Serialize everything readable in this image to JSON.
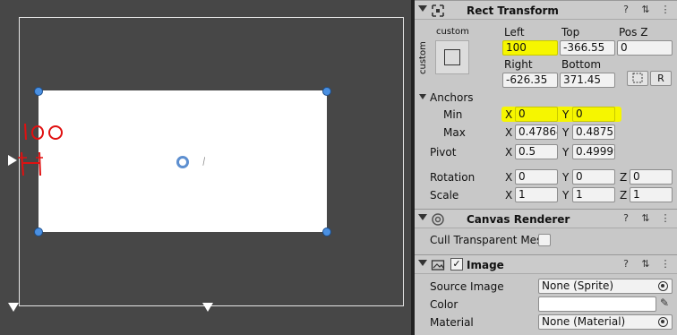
{
  "scene": {
    "annotation_text": "100"
  },
  "rect_transform": {
    "title": "Rect Transform",
    "anchor_preset_top": "custom",
    "anchor_preset_side": "custom",
    "left_label": "Left",
    "left_value": "100",
    "top_label": "Top",
    "top_value": "-366.55",
    "posz_label": "Pos Z",
    "posz_value": "0",
    "right_label": "Right",
    "right_value": "-626.35",
    "bottom_label": "Bottom",
    "bottom_value": "371.45",
    "raw_button": "R",
    "anchors_label": "Anchors",
    "min_label": "Min",
    "min_x": "0",
    "min_y": "0",
    "max_label": "Max",
    "max_x": "0.47864",
    "max_y": "0.4875",
    "pivot_label": "Pivot",
    "pivot_x": "0.5",
    "pivot_y": "0.49999",
    "rotation_label": "Rotation",
    "rot_x": "0",
    "rot_y": "0",
    "rot_z": "0",
    "scale_label": "Scale",
    "scale_x": "1",
    "scale_y": "1",
    "scale_z": "1",
    "x_label": "X",
    "y_label": "Y",
    "z_label": "Z"
  },
  "canvas_renderer": {
    "title": "Canvas Renderer",
    "cull_label": "Cull Transparent Mes"
  },
  "image": {
    "title": "Image",
    "enabled_check": "✓",
    "source_label": "Source Image",
    "source_value": "None (Sprite)",
    "color_label": "Color",
    "material_label": "Material",
    "material_value": "None (Material)"
  },
  "colors": {
    "highlight": "#f6f600",
    "handle": "#4a90e2",
    "annotation": "#e01010"
  }
}
